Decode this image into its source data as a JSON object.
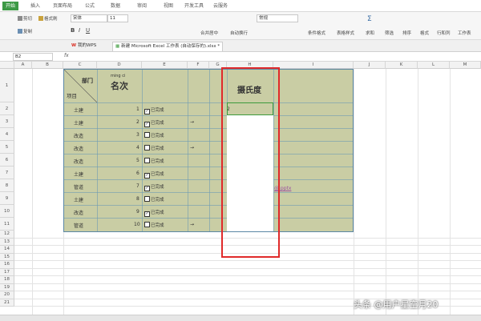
{
  "menu": {
    "tabs": [
      "开始",
      "插入",
      "页面布局",
      "公式",
      "数据",
      "审阅",
      "视图",
      "开发工具",
      "云服务"
    ]
  },
  "ribbon": {
    "cut": "剪切",
    "copy": "复制",
    "format_painter": "格式刷",
    "font_name": "宋体",
    "font_size": "11",
    "merge_center": "合并居中",
    "wrap_text": "自动换行",
    "number_format": "常规",
    "cond_format": "条件格式",
    "table_style": "表格样式",
    "sum": "求和",
    "filter": "筛选",
    "sort": "排序",
    "format": "格式",
    "rows_cols": "行和列",
    "worksheet": "工作表"
  },
  "doctabs": [
    "我的WPS",
    "新建 Microsoft Excel 工作表 (自动保存的).xlsx *"
  ],
  "formula_bar": {
    "cell_ref": "B2",
    "fx": "fx"
  },
  "columns": [
    "A",
    "B",
    "C",
    "D",
    "E",
    "F",
    "G",
    "H",
    "I",
    "J",
    "K",
    "L",
    "M",
    "N"
  ],
  "rows": [
    "1",
    "2",
    "3",
    "4",
    "5",
    "6",
    "7",
    "8",
    "9",
    "10",
    "11",
    "12",
    "13",
    "14",
    "15",
    "16",
    "17",
    "18",
    "19",
    "20",
    "21"
  ],
  "table": {
    "corner_top": "部门",
    "corner_bottom": "项目",
    "pinyin": "ming ci",
    "rank_header": "名次",
    "temp_header": "摄氏度",
    "rows": [
      {
        "dept": "土建",
        "rank": "1",
        "status": "已完成",
        "checked": true,
        "arrow": "",
        "g": "2"
      },
      {
        "dept": "土建",
        "rank": "2",
        "status": "已完成",
        "checked": true,
        "arrow": "→",
        "g": "2"
      },
      {
        "dept": "改造",
        "rank": "3",
        "status": "已完成",
        "checked": false,
        "arrow": "",
        "g": "2"
      },
      {
        "dept": "改造",
        "rank": "4",
        "status": "已完成",
        "checked": false,
        "arrow": "→",
        "g": "2"
      },
      {
        "dept": "改造",
        "rank": "5",
        "status": "已完成",
        "checked": false,
        "arrow": "",
        "g": "2"
      },
      {
        "dept": "土建",
        "rank": "6",
        "status": "已完成",
        "checked": true,
        "arrow": "",
        "g": "2"
      },
      {
        "dept": "管道",
        "rank": "7",
        "status": "已完成",
        "checked": true,
        "arrow": "",
        "g": "E"
      },
      {
        "dept": "土建",
        "rank": "8",
        "status": "已完成",
        "checked": false,
        "arrow": "",
        "g": "2"
      },
      {
        "dept": "改造",
        "rank": "9",
        "status": "已完成",
        "checked": true,
        "arrow": "",
        "g": "E"
      },
      {
        "dept": "管道",
        "rank": "10",
        "status": "已完成",
        "checked": false,
        "arrow": "→",
        "g": "2"
      }
    ]
  },
  "link_text": "@.pptx",
  "watermark": "头条 @用户星空月20"
}
